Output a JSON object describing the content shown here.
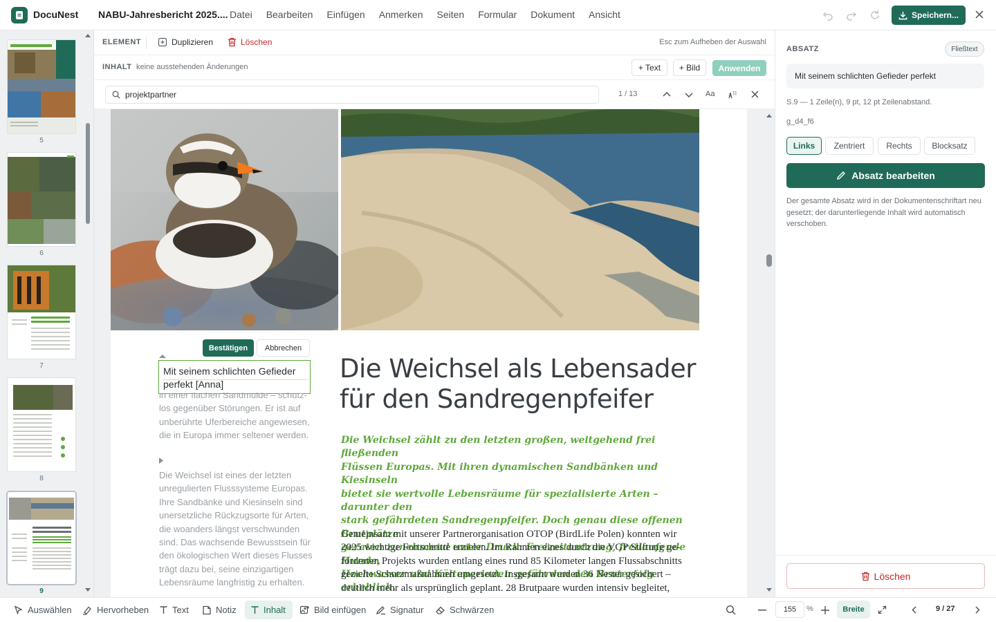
{
  "app": {
    "name": "DocuNest",
    "document_title": "NABU-Jahresbericht 2025...."
  },
  "menu": [
    "Datei",
    "Bearbeiten",
    "Einfügen",
    "Anmerken",
    "Seiten",
    "Formular",
    "Dokument",
    "Ansicht"
  ],
  "header": {
    "save_label": "Speichern..."
  },
  "colors": {
    "accent": "#1f6b58",
    "accent_light": "#8fcfbe",
    "lead_green": "#5fa83c",
    "danger": "#c62828"
  },
  "thumbnails": [
    {
      "label": "5",
      "selected": false
    },
    {
      "label": "6",
      "selected": false
    },
    {
      "label": "7",
      "selected": false
    },
    {
      "label": "8",
      "selected": false
    },
    {
      "label": "9",
      "selected": true
    }
  ],
  "element_bar": {
    "label": "ELEMENT",
    "duplicate": "Duplizieren",
    "delete": "Löschen",
    "hint": "Esc zum Aufheben der Auswahl"
  },
  "content_bar": {
    "label": "INHALT",
    "status": "keine ausstehenden Änderungen",
    "add_text": "+ Text",
    "add_image": "+ Bild",
    "apply": "Anwenden"
  },
  "search": {
    "value": "projektpartner",
    "counter": "1 / 13",
    "case_label": "Aa"
  },
  "page": {
    "edit_value_line1": "Mit seinem schlichten Gefieder",
    "edit_value_line2": "perfekt  [Anna]",
    "confirm": "Bestätigen",
    "cancel": "Abbrechen",
    "caption_lines": [
      "in einer flachen Sandmulde – schutz-",
      "los gegenüber Störungen. Er ist auf",
      "unberührte Uferbereiche angewiesen,",
      "die in Europa immer seltener werden."
    ],
    "side_paragraph": [
      "Die Weichsel ist eines der letzten",
      "unregulierten Flusssysteme Europas.",
      "Ihre Sandbänke und Kiesinseln sind",
      "unersetzliche Rückzugsorte für Arten,",
      "die woanders längst verschwunden",
      "sind. Das wachsende Bewusstsein für",
      "den ökologischen Wert dieses Flusses",
      "trägt dazu bei, seine einzigartigen",
      "Lebensräume langfristig zu erhalten."
    ],
    "headline_line1": "Die Weichsel als Lebensader",
    "headline_line2": "für den Sandregenpfeifer",
    "lead": [
      "Die Weichsel zählt zu den letzten großen, weitgehend frei fließenden",
      "Flüssen Europas. Mit ihren dynamischen Sandbänken und Kiesinseln",
      "bietet sie wertvolle Lebensräume für spezialisierte Arten – darunter den",
      "stark gefährdeten Sandregenpfeifer. Doch genau diese offenen Brutplätze",
      "geraten zunehmend unter Druck: Freizeitnutzung, freilaufende Hunde,",
      "Hochwasser und Kälteperioden gefährden den Bruterfolg erheblich."
    ],
    "body": [
      "Gemeinsam mit unserer Partnerorganisation OTOP (BirdLife Polen) konnten wir",
      "2025 wichtige Fortschritte erzielen. Im Rahmen eines durch die VGP Stiftung ge-",
      "förderten Projekts wurden entlang eines rund 85 Kilometer langen Flussabschnitts",
      "gezielte Schutzmaßnahmen umgesetzt. Insgesamt wurden 36 Nester gesichert –",
      "deutlich mehr als ursprünglich geplant. 28 Brutpaare wurden intensiv begleitet,"
    ]
  },
  "panel": {
    "section_label": "ABSATZ",
    "style_pill": "Fließtext",
    "preview": "Mit seinem schlichten Gefieder perfekt",
    "meta": "S.9 — 1 Zeile(n), 9 pt, 12 pt Zeilenabstand.",
    "id": "g_d4_f6",
    "align": {
      "left": "Links",
      "center": "Zentriert",
      "right": "Rechts",
      "justify": "Blocksatz",
      "active": "Links"
    },
    "edit_button": "Absatz bearbeiten",
    "info": "Der gesamte Absatz wird in der Dokumentenschriftart neu gesetzt; der darunterliegende Inhalt wird automatisch verschoben.",
    "delete_button": "Löschen"
  },
  "bottombar": {
    "tools": [
      "Auswählen",
      "Hervorheben",
      "Text",
      "Notiz",
      "Inhalt",
      "Bild einfügen",
      "Signatur",
      "Schwärzen"
    ],
    "active_tool": "Inhalt",
    "zoom": "155",
    "zoom_unit": "%",
    "fit": "Breite",
    "page_indicator": "9 / 27"
  }
}
